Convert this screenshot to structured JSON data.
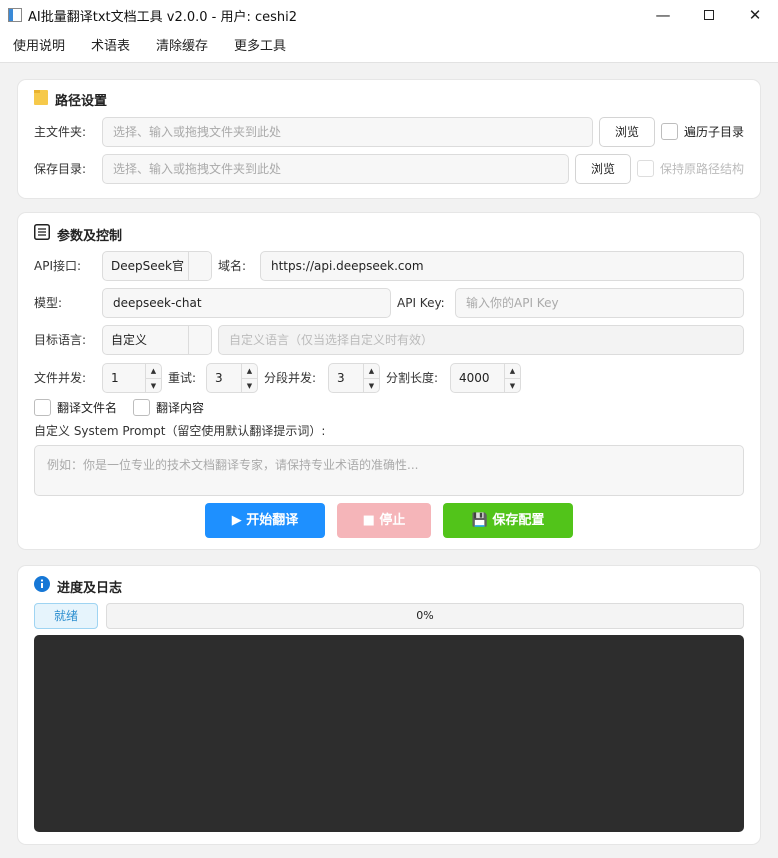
{
  "window": {
    "title": "AI批量翻译txt文档工具 v2.0.0 - 用户: ceshi2",
    "minimize": "—",
    "close": "✕"
  },
  "menu": [
    "使用说明",
    "术语表",
    "清除缓存",
    "更多工具"
  ],
  "path_section": {
    "title": "路径设置",
    "main_folder_label": "主文件夹:",
    "main_folder_placeholder": "选择、输入或拖拽文件夹到此处",
    "save_dir_label": "保存目录:",
    "save_dir_placeholder": "选择、输入或拖拽文件夹到此处",
    "browse_label": "浏览",
    "recurse_label": "遍历子目录",
    "keep_structure_label": "保持原路径结构"
  },
  "params_section": {
    "title": "参数及控制",
    "api_label": "API接口:",
    "api_value": "DeepSeek官",
    "domain_label": "域名:",
    "domain_value": "https://api.deepseek.com",
    "model_label": "模型:",
    "model_value": "deepseek-chat",
    "apikey_label": "API Key:",
    "apikey_placeholder": "输入你的API Key",
    "target_lang_label": "目标语言:",
    "target_lang_value": "自定义",
    "custom_lang_placeholder": "自定义语言（仅当选择自定义时有效）",
    "file_concurrency_label": "文件并发:",
    "file_concurrency_value": "1",
    "retry_label": "重试:",
    "retry_value": "3",
    "segment_concurrency_label": "分段并发:",
    "segment_concurrency_value": "3",
    "split_length_label": "分割长度:",
    "split_length_value": "4000",
    "translate_filename_label": "翻译文件名",
    "translate_content_label": "翻译内容",
    "system_prompt_label": "自定义 System Prompt（留空使用默认翻译提示词）:",
    "system_prompt_placeholder": "例如：你是一位专业的技术文档翻译专家，请保持专业术语的准确性..."
  },
  "buttons": {
    "start": "▶ 开始翻译",
    "stop": "■ 停止",
    "save": "💾 保存配置"
  },
  "progress_section": {
    "title": "进度及日志",
    "status": "就绪",
    "progress_percent": 0,
    "progress_text": "0%"
  },
  "colors": {
    "start": "#1e90ff",
    "stop": "#f5b5b9",
    "save": "#52c41a",
    "info_icon": "#1677d6",
    "folder_icon": "#f6c94a",
    "log_bg": "#2d2d2d"
  }
}
